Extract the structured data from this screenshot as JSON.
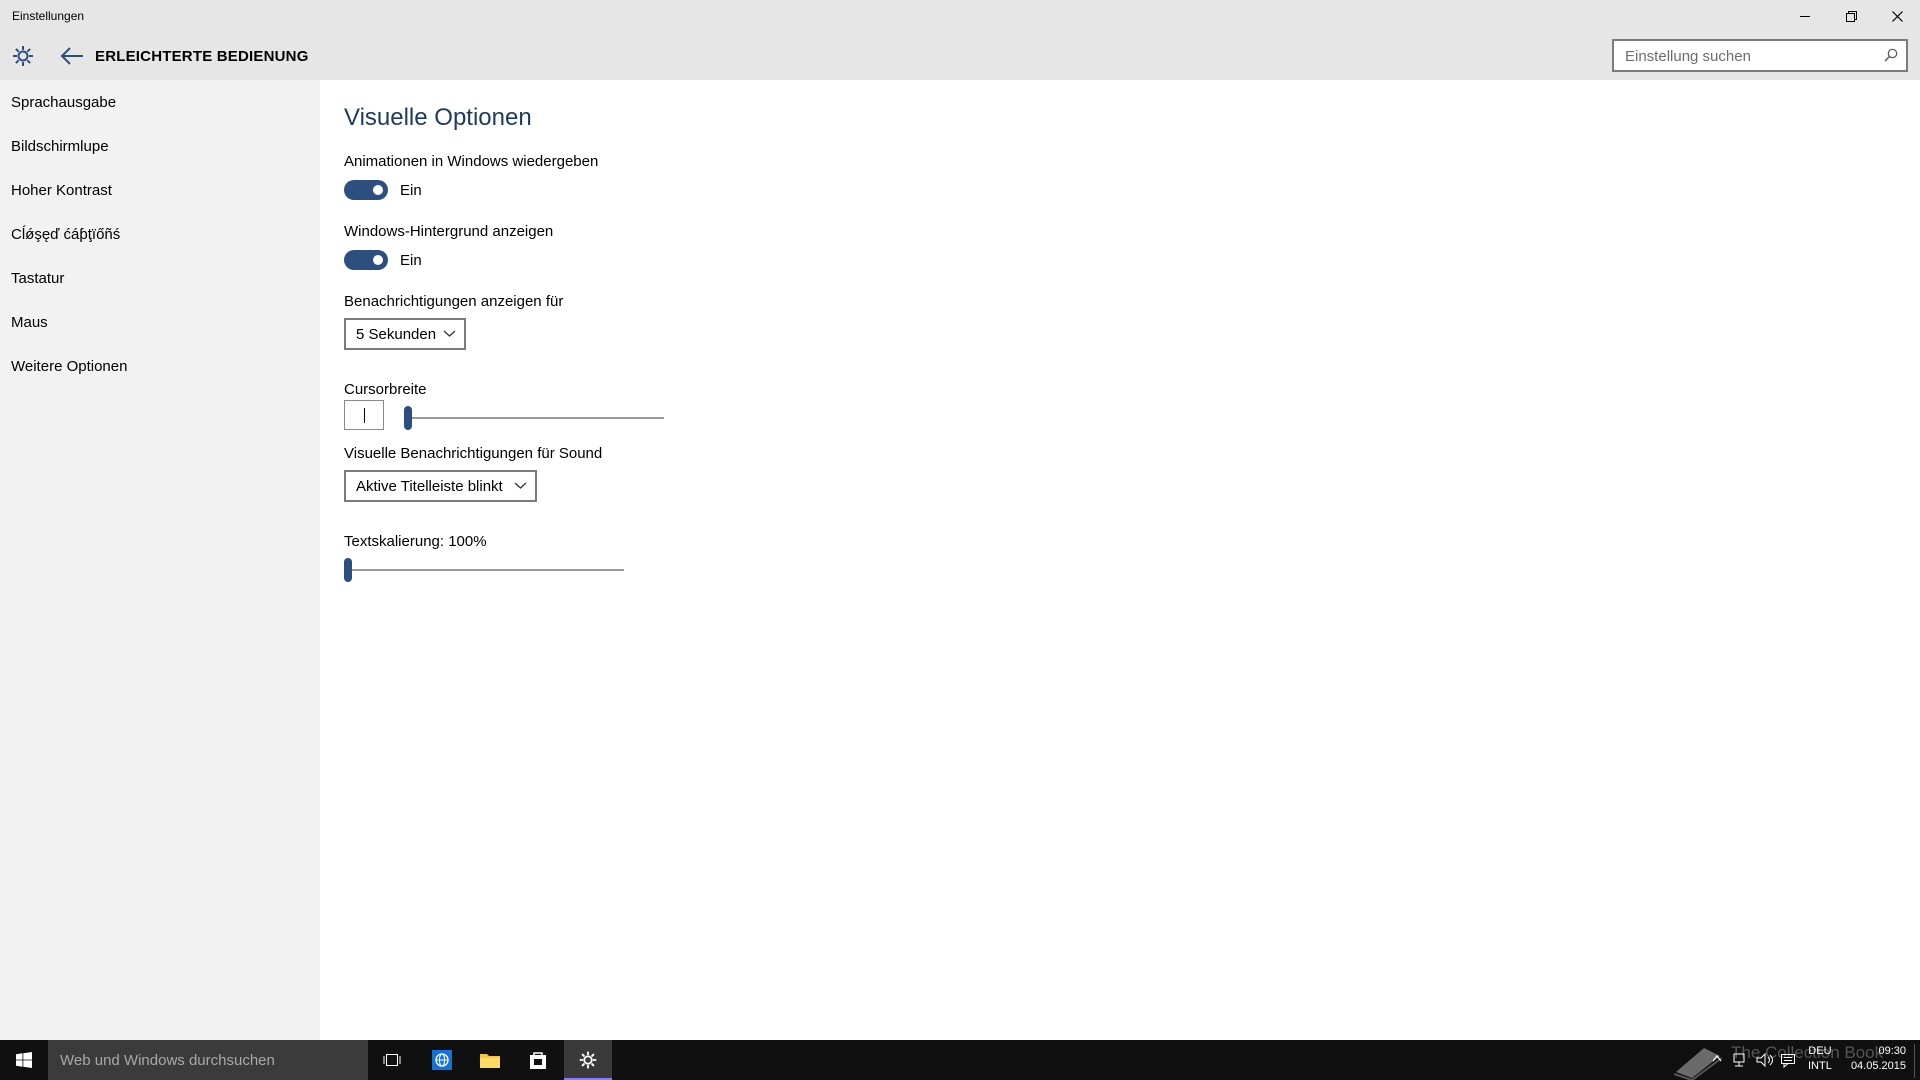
{
  "window": {
    "title": "Einstellungen"
  },
  "header": {
    "section_title": "ERLEICHTERTE BEDIENUNG",
    "search_placeholder": "Einstellung suchen"
  },
  "sidebar": {
    "items": [
      {
        "label": "Sprachausgabe"
      },
      {
        "label": "Bildschirmlupe"
      },
      {
        "label": "Hoher Kontrast"
      },
      {
        "label": "Cĺǿşęď ćáƥţïőñś"
      },
      {
        "label": "Tastatur"
      },
      {
        "label": "Maus"
      },
      {
        "label": "Weitere Optionen"
      }
    ]
  },
  "main": {
    "title": "Visuelle Optionen",
    "animations": {
      "label": "Animationen in Windows wiedergeben",
      "state": "Ein",
      "on": true
    },
    "background": {
      "label": "Windows-Hintergrund anzeigen",
      "state": "Ein",
      "on": true
    },
    "notifications": {
      "label": "Benachrichtigungen anzeigen für",
      "value": "5 Sekunden"
    },
    "cursor": {
      "label": "Cursorbreite",
      "value": 1
    },
    "sound_notifications": {
      "label": "Visuelle Benachrichtigungen für Sound",
      "value": "Aktive Titelleiste blinkt"
    },
    "text_scaling": {
      "label": "Textskalierung: 100%",
      "value_percent": 100
    }
  },
  "taskbar": {
    "search_placeholder": "Web und Windows durchsuchen",
    "language": "DEU",
    "layout": "INTL",
    "time": "09:30",
    "date": "04.05.2015",
    "watermark": "The Collection Book"
  },
  "colors": {
    "accent": "#2c4f7f",
    "title_text": "#1e3a5c",
    "chrome": "#e6e6e6",
    "sidebar": "#f2f2f2",
    "taskbar": "#101010"
  }
}
